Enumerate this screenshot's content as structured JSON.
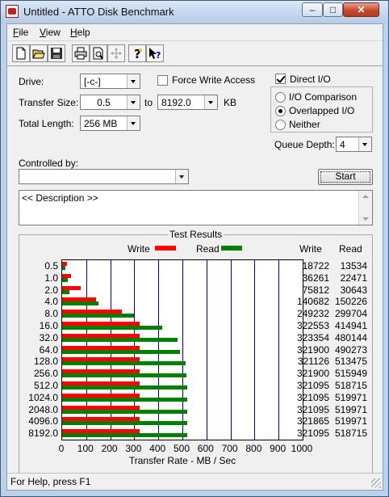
{
  "window": {
    "title": "Untitled - ATTO Disk Benchmark"
  },
  "menu": {
    "items": [
      "File",
      "View",
      "Help"
    ]
  },
  "toolbar": {
    "buttons": [
      "new-icon",
      "open-icon",
      "save-icon",
      "print-icon",
      "print-preview-icon",
      "move-icon",
      "help-icon",
      "context-help-icon"
    ]
  },
  "drive": {
    "label": "Drive:",
    "value": "[-c-]"
  },
  "force_write": {
    "label": "Force Write Access",
    "checked": false
  },
  "direct_io": {
    "label": "Direct I/O",
    "checked": true
  },
  "transfer": {
    "label": "Transfer Size:",
    "from": "0.5",
    "to_label": "to",
    "to": "8192.0",
    "unit": "KB"
  },
  "total_length": {
    "label": "Total Length:",
    "value": "256 MB"
  },
  "io_mode": {
    "options": [
      "I/O Comparison",
      "Overlapped I/O",
      "Neither"
    ],
    "selected": "Overlapped I/O"
  },
  "queue_depth": {
    "label": "Queue Depth:",
    "value": "4"
  },
  "controlled_by": {
    "label": "Controlled by:",
    "value": ""
  },
  "start_button": {
    "label": "Start"
  },
  "description": {
    "text": "<< Description >>"
  },
  "results": {
    "title": "Test Results",
    "col_write": "Write",
    "col_read": "Read",
    "legend_write": "Write",
    "legend_read": "Read",
    "write_values": [
      "18722",
      "36261",
      "75812",
      "140682",
      "249232",
      "322553",
      "323354",
      "321900",
      "321126",
      "321900",
      "321095",
      "321095",
      "321095",
      "321865",
      "321095"
    ],
    "read_values": [
      "13534",
      "22471",
      "30643",
      "150226",
      "299704",
      "414941",
      "480144",
      "490273",
      "513475",
      "515949",
      "518715",
      "519971",
      "519971",
      "519971",
      "518715"
    ]
  },
  "chart_data": {
    "type": "bar",
    "orientation": "horizontal",
    "categories": [
      "0.5",
      "1.0",
      "2.0",
      "4.0",
      "8.0",
      "16.0",
      "32.0",
      "64.0",
      "128.0",
      "256.0",
      "512.0",
      "1024.0",
      "2048.0",
      "4096.0",
      "8192.0"
    ],
    "series": [
      {
        "name": "Write",
        "color": "#ff0000",
        "values": [
          18.7,
          36.3,
          75.8,
          140.7,
          249.2,
          322.6,
          323.4,
          321.9,
          321.1,
          321.9,
          321.1,
          321.1,
          321.1,
          321.9,
          321.1
        ]
      },
      {
        "name": "Read",
        "color": "#008000",
        "values": [
          13.5,
          22.5,
          30.6,
          150.2,
          299.7,
          414.9,
          480.1,
          490.3,
          513.5,
          515.9,
          518.7,
          520.0,
          520.0,
          520.0,
          518.7
        ]
      }
    ],
    "xlabel": "Transfer Rate - MB / Sec",
    "x_ticks": [
      "0",
      "100",
      "200",
      "300",
      "400",
      "500",
      "600",
      "700",
      "800",
      "900",
      "1000"
    ],
    "xlim": [
      0,
      1000
    ],
    "grid": "vertical"
  },
  "status": {
    "text": "For Help, press F1"
  },
  "colors": {
    "write": "#ff0000",
    "read": "#008000",
    "grid": "#0000a0"
  }
}
